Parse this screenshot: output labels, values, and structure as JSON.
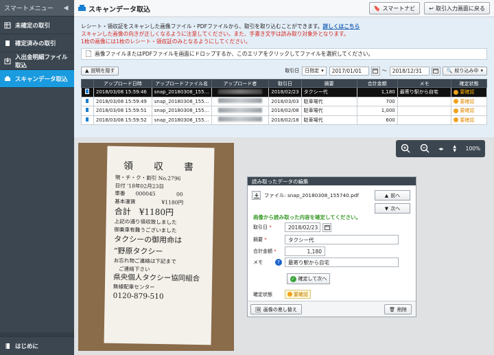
{
  "sidebar": {
    "header": "スマートメニュー",
    "items": [
      {
        "label": "未確定の取引",
        "icon": "table-icon"
      },
      {
        "label": "確定済みの取引",
        "icon": "document-icon"
      },
      {
        "label": "入出金明細ファイル取込",
        "icon": "import-icon"
      },
      {
        "label": "スキャンデータ取込",
        "icon": "scan-icon",
        "active": true
      }
    ],
    "bottom_item": "はじめに"
  },
  "topbar": {
    "title": "スキャンデータ取込",
    "smart_navi": "スマートナビ",
    "back": "取引入力画面に戻る"
  },
  "info": {
    "line1": "レシート・領収証をスキャンした画像ファイル・PDFファイルから、取引を取り込むことができます。",
    "link": "詳しくはこちら",
    "line2": "スキャンした画像の向きが正しくなるように注意してください。また、手書き文字は読み取り対象外となります。",
    "line3": "1枚の画像には1枚のレシート・領収証のみとなるようにしてください。",
    "dropzone": "画像ファイルまたはPDFファイルを画面にドロップするか、このエリアをクリックしてファイルを選択してください。"
  },
  "filter": {
    "hide_desc": "説明を隠す",
    "date_label": "取引日",
    "mode": "日指定",
    "from": "2017/01/01",
    "sep": "〜",
    "to": "2018/12/31",
    "narrow": "絞り込み中"
  },
  "table": {
    "headers": [
      "",
      "アップロード日時",
      "アップロードファイル名",
      "アップロード者",
      "取引日",
      "摘要",
      "合計金額",
      "メモ",
      "確定状態"
    ],
    "rows": [
      {
        "uploaded": "2018/03/08 15:59:46",
        "file": "snap_20180308_155…",
        "date": "2018/02/23",
        "desc": "タクシー代",
        "amount": "1,180",
        "memo": "最寄り駅から自宅",
        "status": "要確認",
        "selected": true
      },
      {
        "uploaded": "2018/03/08 15:59:49",
        "file": "snap_20180308_155…",
        "date": "2018/03/03",
        "desc": "駐車場代",
        "amount": "700",
        "memo": "",
        "status": "要確認"
      },
      {
        "uploaded": "2018/03/08 15:59:51",
        "file": "snap_20180308_155…",
        "date": "2018/02/08",
        "desc": "駐車場代",
        "amount": "1,000",
        "memo": "",
        "status": "要確認"
      },
      {
        "uploaded": "2018/03/08 15:59:52",
        "file": "snap_20180308_155…",
        "date": "2018/02/18",
        "desc": "駐車場代",
        "amount": "600",
        "memo": "",
        "status": "要確認"
      }
    ]
  },
  "zoom": {
    "level": "100%"
  },
  "receipt": {
    "title": "領　収　書",
    "line1": "現・チ・ク・割引 No.2796",
    "line2": "日付 '18年02月23日",
    "line3": "車番　　000045　　　　00",
    "line4": "基本運賃　　　　　¥1180円",
    "total": "合計　¥1180円",
    "line5": "上記の通り領収致しました",
    "line6": "御乗車有難うございました",
    "line7": "タクシーの御用命は",
    "line8": "”野原タクシー",
    "line9": "お忘れ物ご連絡は下記まで",
    "line10": "　ご連絡下さい",
    "line11": "県央個人タクシー協同組合",
    "line12": "無線配車センター",
    "line13": "0120-879-510"
  },
  "panel": {
    "title": "読み取ったデータの編集",
    "file_label": "ファイル: snap_20180308_155740.pdf",
    "prev": "前へ",
    "next": "次へ",
    "message": "画像から読み取った内容を確定してください。",
    "date_label": "取引日",
    "date_value": "2018/02/23",
    "desc_label": "摘要",
    "desc_value": "タクシー代",
    "amount_label": "合計金額",
    "amount_value": "1,180",
    "memo_label": "メモ",
    "memo_value": "最寄り駅から自宅",
    "confirm_next": "確定して次へ",
    "status_label": "確定状態",
    "status_value": "要確認",
    "replace": "画像の差し替え",
    "delete": "削除"
  }
}
